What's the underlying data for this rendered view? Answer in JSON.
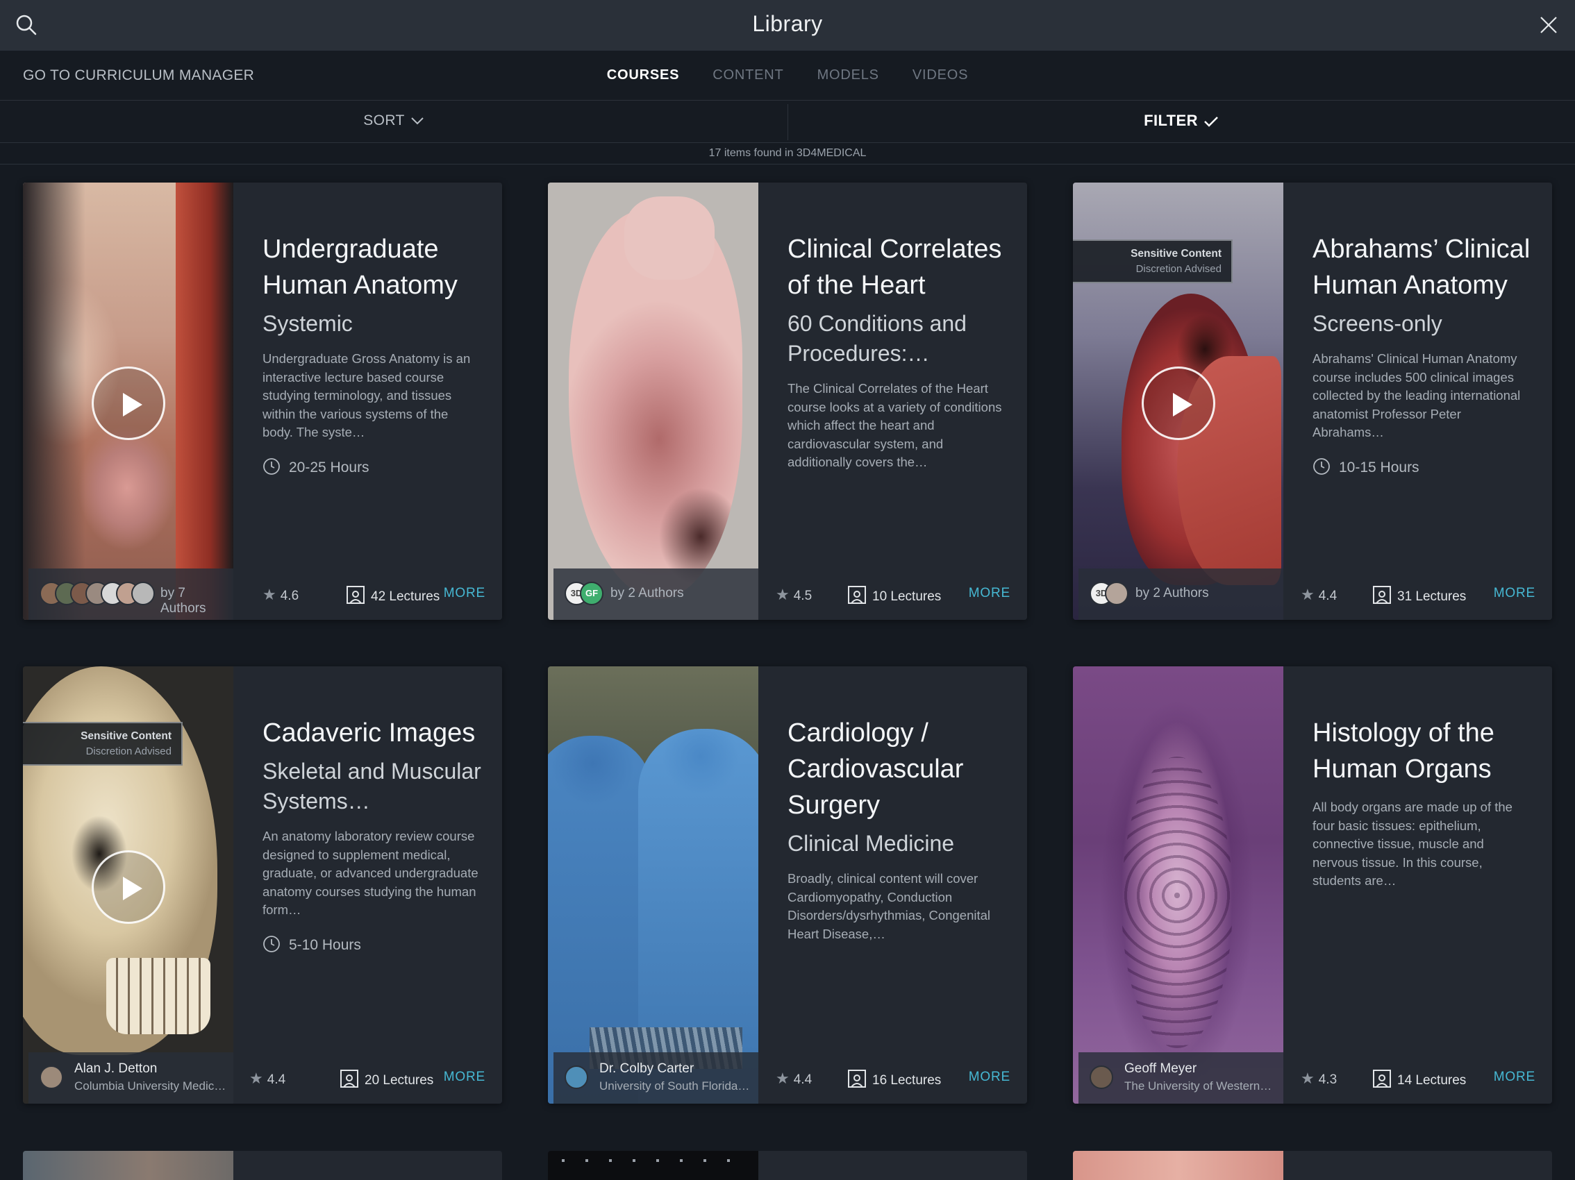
{
  "header": {
    "title": "Library"
  },
  "nav": {
    "curriculum_label": "GO TO CURRICULUM MANAGER",
    "tabs": [
      {
        "label": "COURSES",
        "active": true
      },
      {
        "label": "CONTENT",
        "active": false
      },
      {
        "label": "MODELS",
        "active": false
      },
      {
        "label": "VIDEOS",
        "active": false
      }
    ]
  },
  "toolbar": {
    "sort_label": "SORT",
    "filter_label": "FILTER",
    "items_found": "17 items found in 3D4MEDICAL"
  },
  "sensitive": {
    "title": "Sensitive Content",
    "note": "Discretion Advised"
  },
  "courses": [
    {
      "title": "Undergraduate Human Anatomy",
      "subtitle": "Systemic",
      "description": "Undergraduate Gross Anatomy is an interactive lecture based course studying terminology, and tissues within the various systems of the body. The syste…",
      "hours": "20-25 Hours",
      "authors_text": "by 7 Authors",
      "rating": "4.6",
      "lectures": "42 Lectures",
      "more": "MORE"
    },
    {
      "title": "Clinical Correlates of the Heart",
      "subtitle": "60 Conditions and Procedures:…",
      "description": "The Clinical Correlates of the Heart course looks at a variety of conditions which affect the heart and cardiovascular system, and additionally covers the…",
      "authors_text": "by 2 Authors",
      "rating": "4.5",
      "lectures": "10 Lectures",
      "more": "MORE"
    },
    {
      "title": "Abrahams’ Clinical Human Anatomy",
      "subtitle": "Screens-only",
      "description": "Abrahams' Clinical Human Anatomy course includes 500 clinical images collected by the leading international anatomist Professor Peter Abrahams…",
      "hours": "10-15 Hours",
      "authors_text": "by 2 Authors",
      "rating": "4.4",
      "lectures": "31 Lectures",
      "more": "MORE"
    },
    {
      "title": "Cadaveric Images",
      "subtitle": "Skeletal and Muscular Systems…",
      "description": "An anatomy laboratory review course designed to supplement medical, graduate, or advanced undergraduate anatomy courses studying the human form…",
      "hours": "5-10 Hours",
      "author_name": "Alan J. Detton",
      "author_affiliation": "Columbia University Medic…",
      "rating": "4.4",
      "lectures": "20 Lectures",
      "more": "MORE"
    },
    {
      "title": "Cardiology / Cardiovascular Surgery",
      "subtitle": "Clinical Medicine",
      "description": "Broadly, clinical content will cover Cardiomyopathy, Conduction Disorders/dysrhythmias, Congenital Heart Disease,…",
      "author_name": "Dr. Colby Carter",
      "author_affiliation": "University of South Florida,…",
      "rating": "4.4",
      "lectures": "16 Lectures",
      "more": "MORE"
    },
    {
      "title": "Histology of the Human Organs",
      "description": "All body organs are made up of the four basic tissues: epithelium, connective tissue, muscle and nervous tissue. In this course, students are…",
      "author_name": "Geoff Meyer",
      "author_affiliation": "The University of Western…",
      "rating": "4.3",
      "lectures": "14 Lectures",
      "more": "MORE"
    }
  ],
  "logo_badge": {
    "text_3d": "3D",
    "text_gf": "GF"
  },
  "colors": {
    "accent": "#46b8d3",
    "background": "#151a21",
    "card": "#232830",
    "header": "#2a3039"
  }
}
